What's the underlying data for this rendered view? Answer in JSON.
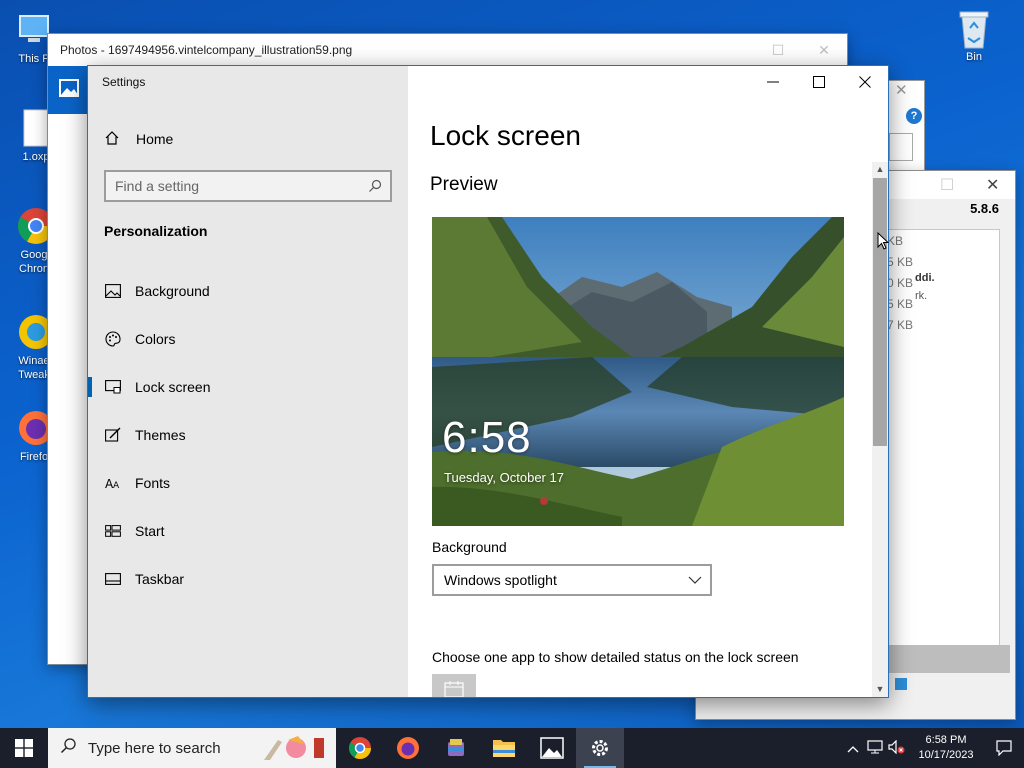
{
  "desktop": {
    "icons": [
      {
        "label": "This P",
        "icon": "computer-icon"
      },
      {
        "label": "1.oxp",
        "icon": "file-icon"
      },
      {
        "label": "Goog\nChron",
        "icon": "chrome-icon"
      },
      {
        "label": "Winae\nTweak",
        "icon": "winaero-icon"
      },
      {
        "label": "Firefo",
        "icon": "firefox-icon"
      },
      {
        "label": "Bin",
        "icon": "recycle-bin-icon"
      }
    ]
  },
  "photos_window": {
    "title": "Photos - 1697494956.vintelcompany_illustration59.png"
  },
  "winrar_window": {
    "version": "5.8.6",
    "sizes": [
      "KB",
      "5 KB",
      "0 KB",
      "5 KB",
      "7 KB"
    ],
    "info": [
      "ddi.",
      "rk."
    ]
  },
  "settings": {
    "app_title": "Settings",
    "home_label": "Home",
    "search_placeholder": "Find a setting",
    "section": "Personalization",
    "nav": [
      {
        "label": "Background",
        "icon": "picture-icon"
      },
      {
        "label": "Colors",
        "icon": "palette-icon"
      },
      {
        "label": "Lock screen",
        "icon": "lock-screen-icon",
        "active": true
      },
      {
        "label": "Themes",
        "icon": "brush-icon"
      },
      {
        "label": "Fonts",
        "icon": "font-icon"
      },
      {
        "label": "Start",
        "icon": "start-grid-icon"
      },
      {
        "label": "Taskbar",
        "icon": "taskbar-icon"
      }
    ],
    "page_title": "Lock screen",
    "preview_heading": "Preview",
    "preview_time": "6:58",
    "preview_date": "Tuesday, October 17",
    "background_label": "Background",
    "background_value": "Windows spotlight",
    "status_label": "Choose one app to show detailed status on the lock screen",
    "accent_color": "#0063b1"
  },
  "taskbar": {
    "search_placeholder": "Type here to search",
    "apps": [
      "chrome-icon",
      "firefox-icon",
      "winrar-icon",
      "file-explorer-icon",
      "photos-icon",
      "settings-icon"
    ],
    "active_app": "settings-icon",
    "clock_time": "6:58 PM",
    "clock_date": "10/17/2023"
  }
}
